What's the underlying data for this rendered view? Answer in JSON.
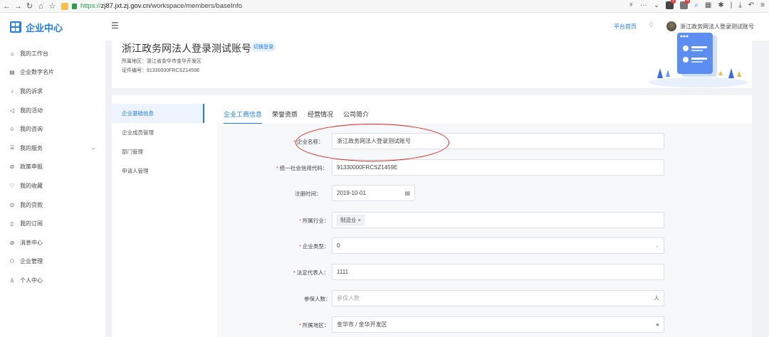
{
  "browser": {
    "url_scheme": "https://",
    "url_domain": "zj87.jxt.zj.gov.cn",
    "url_path": "/workspace/members/baseInfo",
    "badges": [
      "1",
      "4"
    ]
  },
  "sidebar": {
    "title": "企业中心",
    "items": [
      {
        "label": "我的工作台",
        "icon": "home-icon"
      },
      {
        "label": "企业数字名片",
        "icon": "card-icon"
      },
      {
        "label": "我的诉求",
        "icon": "mic-icon"
      },
      {
        "label": "我的活动",
        "icon": "megaphone-icon"
      },
      {
        "label": "我的咨询",
        "icon": "chat-icon"
      },
      {
        "label": "我的服务",
        "icon": "bag-icon",
        "has_arrow": true
      },
      {
        "label": "政策申报",
        "icon": "link-icon"
      },
      {
        "label": "我的收藏",
        "icon": "heart-icon"
      },
      {
        "label": "我的贷款",
        "icon": "coin-icon"
      },
      {
        "label": "我的订阅",
        "icon": "doc-icon"
      },
      {
        "label": "消息中心",
        "icon": "link-icon"
      },
      {
        "label": "企业管理",
        "icon": "team-icon"
      },
      {
        "label": "个人中心",
        "icon": "user-icon"
      }
    ]
  },
  "topbar": {
    "platform_link": "平台首页",
    "username": "浙江政务网法人登录测试账号"
  },
  "profile": {
    "title": "浙江政务网法人登录测试账号",
    "switch_label": "切换登录",
    "region": "所属地区：浙江省金华市金华开发区",
    "cert": "证件编号：91330000FRCSZ1459E"
  },
  "subnav": [
    "企业基础信息",
    "企业成员管理",
    "部门管理",
    "申请人管理"
  ],
  "tabs": [
    "企业工商信息",
    "荣誉资质",
    "经营情况",
    "公司简介"
  ],
  "form": {
    "company_name": {
      "label": "企业名称：",
      "value": "浙江政务网法人登录测试账号",
      "required": true
    },
    "credit_code": {
      "label": "统一社会信用代码：",
      "value": "91330000FRCSZ1459E",
      "required": true
    },
    "reg_date": {
      "label": "注册时间：",
      "value": "2019-10-01",
      "required": false
    },
    "industry": {
      "label": "所属行业：",
      "value": "制造业",
      "required": true
    },
    "company_type": {
      "label": "企业类型：",
      "value": "0",
      "required": true
    },
    "legal_rep": {
      "label": "法定代表人：",
      "value": "1111",
      "required": true
    },
    "insured": {
      "label": "参保人数：",
      "placeholder": "参保人数",
      "suffix": "人",
      "required": false
    },
    "region": {
      "label": "所属地区：",
      "value": "金华市 / 金华开发区",
      "required": true
    }
  },
  "annotation_color": "#e02020",
  "accent_color": "#1e7cf0"
}
